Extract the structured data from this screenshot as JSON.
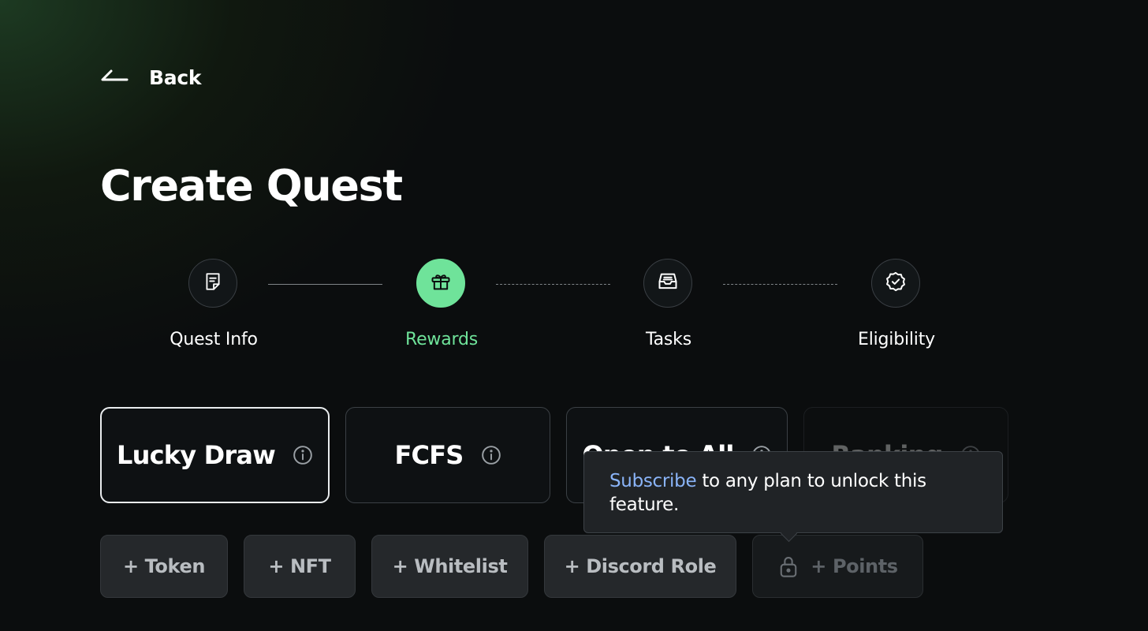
{
  "back": {
    "label": "Back",
    "icon": "arrow-left-icon"
  },
  "page": {
    "title": "Create Quest"
  },
  "steps": [
    {
      "label": "Quest Info",
      "icon": "note-icon",
      "state": "completed"
    },
    {
      "label": "Rewards",
      "icon": "gift-icon",
      "state": "active"
    },
    {
      "label": "Tasks",
      "icon": "inbox-icon",
      "state": "upcoming"
    },
    {
      "label": "Eligibility",
      "icon": "badge-check-icon",
      "state": "upcoming"
    }
  ],
  "reward_types": [
    {
      "label": "Lucky Draw",
      "selected": true,
      "icon": "info-icon"
    },
    {
      "label": "FCFS",
      "selected": false,
      "icon": "info-icon"
    },
    {
      "label": "Open to All",
      "selected": false,
      "icon": "info-icon",
      "partially_hidden": true
    },
    {
      "label": "Ranking",
      "selected": false,
      "icon": "info-icon",
      "disabled": true,
      "partially_hidden": true
    }
  ],
  "reward_items": [
    {
      "label": "+ Token"
    },
    {
      "label": "+ NFT"
    },
    {
      "label": "+ Whitelist"
    },
    {
      "label": "+ Discord Role"
    },
    {
      "label": "+ Points",
      "locked": true,
      "icon": "lock-icon"
    }
  ],
  "tooltip": {
    "link": "Subscribe",
    "text": " to any plan to unlock this feature."
  },
  "colors": {
    "accent": "#6fe39a",
    "link": "#8ab4f8",
    "background": "#0b0d0e",
    "card_border": "#3b4045",
    "chip_bg": "#25282b"
  }
}
